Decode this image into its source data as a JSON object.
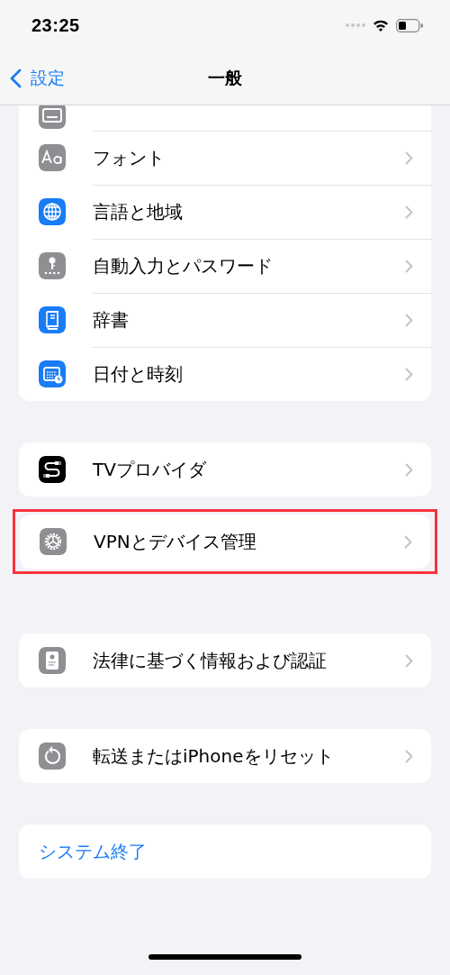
{
  "status_bar": {
    "time": "23:25"
  },
  "nav": {
    "back_label": "設定",
    "title": "一般"
  },
  "sections": [
    {
      "highlighted": false,
      "rows": [
        {
          "kind": "partial",
          "color": "#8e8e93"
        },
        {
          "kind": "link",
          "label": "フォント",
          "color": "#8e8e93"
        },
        {
          "kind": "link",
          "label": "言語と地域",
          "color": "#1a7cf5"
        },
        {
          "kind": "link",
          "label": "自動入力とパスワード",
          "color": "#8e8e93"
        },
        {
          "kind": "link",
          "label": "辞書",
          "color": "#1a7cf5"
        },
        {
          "kind": "link",
          "label": "日付と時刻",
          "color": "#1a7cf5"
        }
      ]
    },
    {
      "highlighted": false,
      "rows": [
        {
          "kind": "link",
          "label": "TVプロバイダ",
          "color": "#000000"
        }
      ]
    },
    {
      "highlighted": true,
      "rows": [
        {
          "kind": "link",
          "label": "VPNとデバイス管理",
          "color": "#8e8e93"
        }
      ]
    },
    {
      "highlighted": false,
      "rows": [
        {
          "kind": "link",
          "label": "法律に基づく情報および認証",
          "color": "#8e8e93"
        }
      ]
    },
    {
      "highlighted": false,
      "rows": [
        {
          "kind": "link",
          "label": "転送またはiPhoneをリセット",
          "color": "#8e8e93"
        }
      ]
    },
    {
      "highlighted": false,
      "rows": [
        {
          "kind": "action",
          "label": "システム終了"
        }
      ]
    }
  ]
}
